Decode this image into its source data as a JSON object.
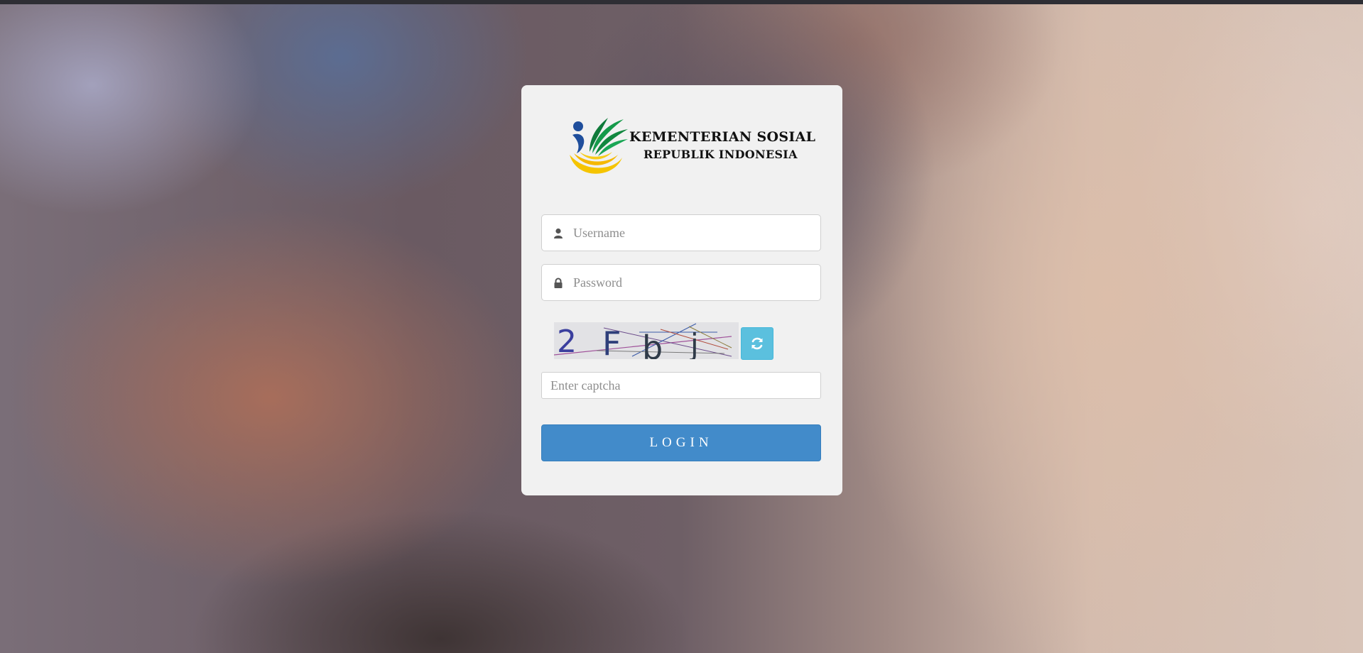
{
  "logo": {
    "line1": "KEMENTERIAN SOSIAL",
    "line2": "REPUBLIK INDONESIA",
    "colors": {
      "blue": "#1f4e9c",
      "green": "#159a4a",
      "yellow": "#f5c400"
    }
  },
  "form": {
    "username": {
      "placeholder": "Username",
      "value": "",
      "icon": "user-icon"
    },
    "password": {
      "placeholder": "Password",
      "value": "",
      "icon": "lock-icon"
    },
    "captcha": {
      "image_text": [
        "2",
        "F",
        "b",
        "j"
      ],
      "refresh_icon": "refresh-icon",
      "placeholder": "Enter captcha"
    },
    "login_label": "LOGIN"
  },
  "colors": {
    "card_bg": "#f1f1f1",
    "login_button": "#428bca",
    "refresh_button": "#5bc0de"
  }
}
